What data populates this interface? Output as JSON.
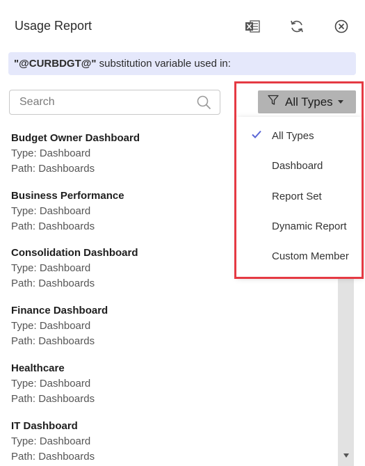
{
  "header": {
    "title": "Usage Report",
    "icons": [
      "excel-export-icon",
      "refresh-icon",
      "close-icon"
    ]
  },
  "banner": {
    "variable": "\"@CURBDGT@\"",
    "text": " substitution variable used in:"
  },
  "search": {
    "placeholder": "Search",
    "value": ""
  },
  "type_filter": {
    "label": "All Types",
    "options": [
      {
        "label": "All Types",
        "selected": true
      },
      {
        "label": "Dashboard",
        "selected": false
      },
      {
        "label": "Report Set",
        "selected": false
      },
      {
        "label": "Dynamic Report",
        "selected": false
      },
      {
        "label": "Custom Member",
        "selected": false
      }
    ]
  },
  "items": [
    {
      "name": "Budget Owner Dashboard",
      "type": "Type: Dashboard",
      "path": "Path: Dashboards"
    },
    {
      "name": "Business Performance",
      "type": "Type: Dashboard",
      "path": "Path: Dashboards"
    },
    {
      "name": "Consolidation Dashboard",
      "type": "Type: Dashboard",
      "path": "Path: Dashboards"
    },
    {
      "name": "Finance Dashboard",
      "type": "Type: Dashboard",
      "path": "Path: Dashboards"
    },
    {
      "name": "Healthcare",
      "type": "Type: Dashboard",
      "path": "Path: Dashboards"
    },
    {
      "name": "IT Dashboard",
      "type": "Type: Dashboard",
      "path": "Path: Dashboards"
    }
  ],
  "colors": {
    "banner_bg": "#e5e8fb",
    "filter_button_bg": "#b3b3b3",
    "check_color": "#5b67d6",
    "highlight_border": "#e53a43"
  }
}
